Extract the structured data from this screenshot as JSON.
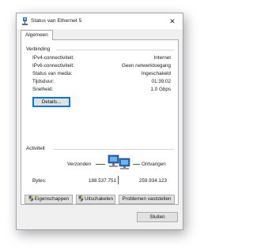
{
  "window": {
    "title": "Status van Ethernet 5",
    "close_symbol": "✕"
  },
  "tabs": [
    {
      "label": "Algemeen",
      "selected": true
    }
  ],
  "connection": {
    "group_title": "Verbinding",
    "rows": [
      {
        "label": "IPv4-connectiviteit:",
        "value": "Internet"
      },
      {
        "label": "IPv6-connectiviteit:",
        "value": "Geen netwerktoegang"
      },
      {
        "label": "Status van media:",
        "value": "Ingeschakeld"
      },
      {
        "label": "Tijdsduur:",
        "value": "01:39:02"
      },
      {
        "label": "Snelheid:",
        "value": "1,0 Gbps"
      }
    ],
    "details_button": "Details..."
  },
  "activity": {
    "group_title": "Activiteit",
    "sent_label": "Verzonden",
    "received_label": "Ontvangen",
    "bytes_label": "Bytes:",
    "bytes_sent": "188.537.751",
    "bytes_received": "259.934.123",
    "icon": "network-computers-icon"
  },
  "actions": {
    "properties": "Eigenschappen",
    "disable": "Uitschakelen",
    "diagnose": "Problemen vaststellen"
  },
  "footer": {
    "close_button": "Sluiten"
  },
  "colors": {
    "focus_border": "#0078d7",
    "window_bg": "#f0f0f0",
    "panel_bg": "#ffffff"
  }
}
